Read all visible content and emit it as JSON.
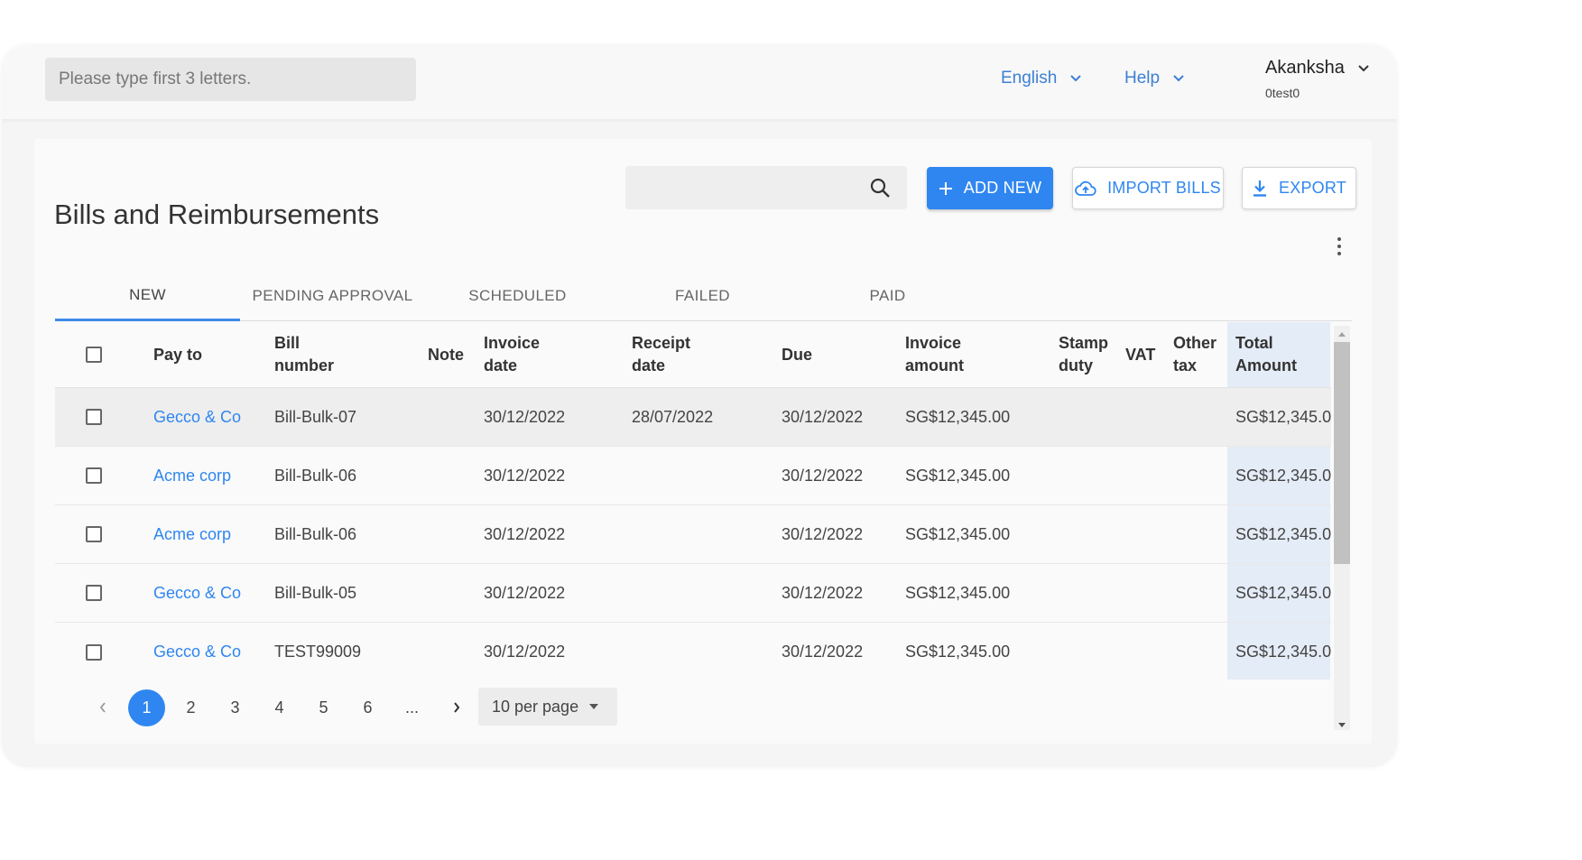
{
  "header": {
    "search_placeholder": "Please type first 3 letters.",
    "language": "English",
    "help": "Help",
    "user_name": "Akanksha",
    "user_id": "0test0"
  },
  "page": {
    "title": "Bills and Reimbursements",
    "add_new": "ADD NEW",
    "import_bills": "IMPORT BILLS",
    "export": "EXPORT"
  },
  "tabs": [
    "NEW",
    "PENDING APPROVAL",
    "SCHEDULED",
    "FAILED",
    "PAID"
  ],
  "active_tab": "NEW",
  "table": {
    "headers": {
      "pay_to": "Pay to",
      "bill_number": "Bill number",
      "note": "Note",
      "invoice_date": "Invoice date",
      "receipt_date": "Receipt date",
      "due": "Due",
      "invoice_amount": "Invoice amount",
      "stamp_duty": "Stamp duty",
      "vat": "VAT",
      "other_tax": "Other tax",
      "total_amount": "Total Amount"
    },
    "rows": [
      {
        "pay_to": "Gecco & Co",
        "bill_number": "Bill-Bulk-07",
        "note": "",
        "invoice_date": "30/12/2022",
        "receipt_date": "28/07/2022",
        "due": "30/12/2022",
        "invoice_amount": "SG$12,345.00",
        "stamp_duty": "",
        "vat": "",
        "other_tax": "",
        "total_amount": "SG$12,345.0"
      },
      {
        "pay_to": "Acme corp",
        "bill_number": "Bill-Bulk-06",
        "note": "",
        "invoice_date": "30/12/2022",
        "receipt_date": "",
        "due": "30/12/2022",
        "invoice_amount": "SG$12,345.00",
        "stamp_duty": "",
        "vat": "",
        "other_tax": "",
        "total_amount": "SG$12,345.0"
      },
      {
        "pay_to": "Acme corp",
        "bill_number": "Bill-Bulk-06",
        "note": "",
        "invoice_date": "30/12/2022",
        "receipt_date": "",
        "due": "30/12/2022",
        "invoice_amount": "SG$12,345.00",
        "stamp_duty": "",
        "vat": "",
        "other_tax": "",
        "total_amount": "SG$12,345.0"
      },
      {
        "pay_to": "Gecco & Co",
        "bill_number": "Bill-Bulk-05",
        "note": "",
        "invoice_date": "30/12/2022",
        "receipt_date": "",
        "due": "30/12/2022",
        "invoice_amount": "SG$12,345.00",
        "stamp_duty": "",
        "vat": "",
        "other_tax": "",
        "total_amount": "SG$12,345.0"
      },
      {
        "pay_to": "Gecco & Co",
        "bill_number": "TEST99009",
        "note": "",
        "invoice_date": "30/12/2022",
        "receipt_date": "",
        "due": "30/12/2022",
        "invoice_amount": "SG$12,345.00",
        "stamp_duty": "",
        "vat": "",
        "other_tax": "",
        "total_amount": "SG$12,345.0"
      }
    ]
  },
  "pagination": {
    "pages": [
      "1",
      "2",
      "3",
      "4",
      "5",
      "6",
      "..."
    ],
    "current": "1",
    "per_page": "10 per page"
  },
  "colors": {
    "accent": "#2f86f0",
    "total_column_bg": "#e4ecf7",
    "highlight_row_bg": "#eeeeee"
  }
}
